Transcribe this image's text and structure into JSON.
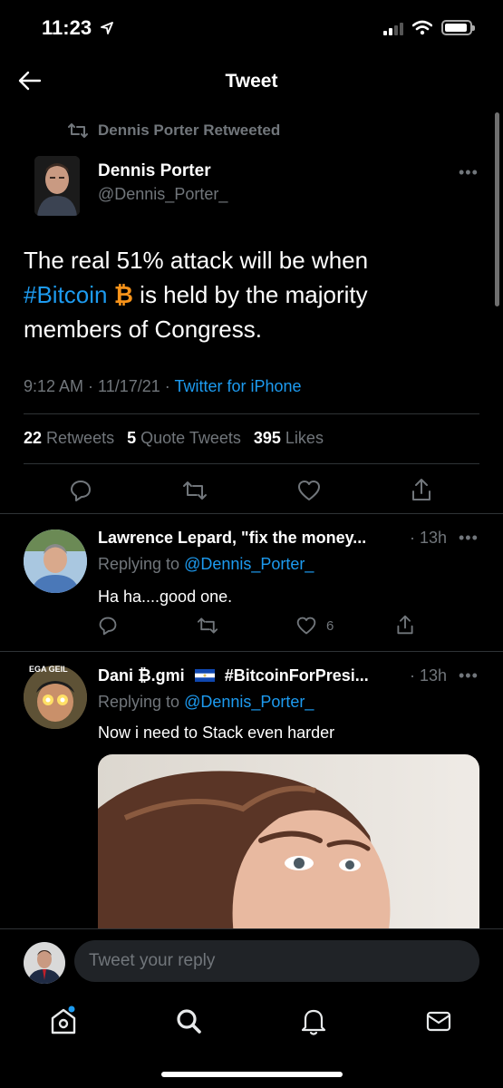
{
  "status_bar": {
    "time": "11:23",
    "location_arrow": "location-arrow-icon"
  },
  "header": {
    "title": "Tweet"
  },
  "main_tweet": {
    "retweet_by": "Dennis Porter Retweeted",
    "author_name": "Dennis Porter",
    "author_handle": "@Dennis_Porter_",
    "text_before": "The real 51% attack will be when",
    "hashtag": "#Bitcoin",
    "emoji": "₿",
    "text_after": "is held by the majority members of Congress.",
    "time": "9:12 AM",
    "date": "11/17/21",
    "source": "Twitter for iPhone",
    "retweets_count": "22",
    "retweets_label": "Retweets",
    "quotes_count": "5",
    "quotes_label": "Quote Tweets",
    "likes_count": "395",
    "likes_label": "Likes"
  },
  "replies": [
    {
      "name": "Lawrence Lepard, \"fix the money...",
      "time": "· 13h",
      "replying_prefix": "Replying to",
      "replying_handle": "@Dennis_Porter_",
      "text": "Ha ha....good one.",
      "likes": "6"
    },
    {
      "name": "Dani ₿.gmi",
      "flag": "flag-el-salvador-icon",
      "hashtag": "#BitcoinForPresi...",
      "time": "· 13h",
      "replying_prefix": "Replying to",
      "replying_handle": "@Dennis_Porter_",
      "text": "Now i need to Stack even harder",
      "avatar_text": "EGA GEIL"
    }
  ],
  "composer": {
    "placeholder": "Tweet your reply"
  },
  "colors": {
    "background": "#000000",
    "accent": "#1d9bf0",
    "muted": "#71767b",
    "bitcoin": "#f7931a"
  }
}
